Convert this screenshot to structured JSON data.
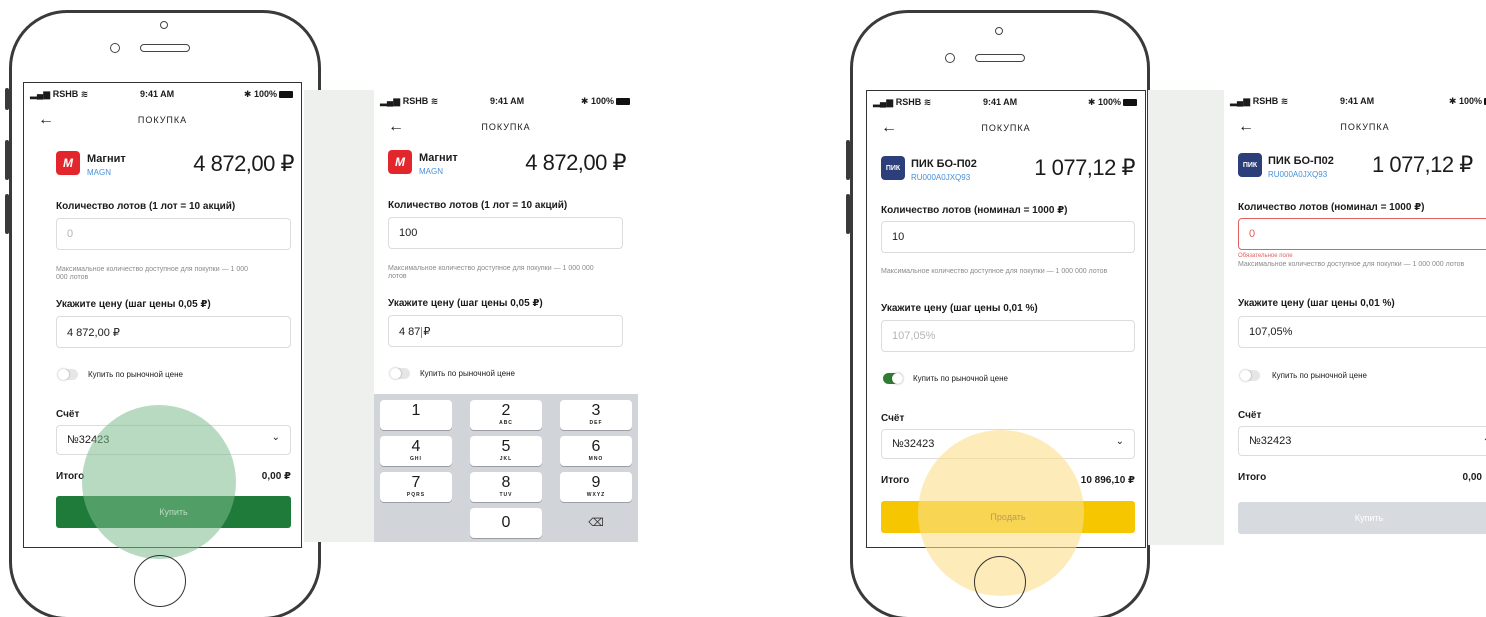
{
  "status_bar": {
    "carrier": "RSHB",
    "wifi": "≋",
    "time": "9:41 AM",
    "battery": "100%"
  },
  "screens": {
    "s1": {
      "nav_title": "ПОКУПКА",
      "back": "←",
      "logo": "M",
      "name": "Магнит",
      "code": "MAGN",
      "price": "4 872,00 ₽",
      "lots_label": "Количество лотов (1 лот = 10 акций)",
      "lots_value": "0",
      "hint": "Максимальное количество доступное для покупки — 1 000 000 лотов",
      "price_label": "Укажите цену (шаг цены 0,05 ₽)",
      "price_value": "4 872,00 ₽",
      "market_label": "Купить по рыночной цене",
      "account_label": "Счёт",
      "account_value": "№32423",
      "total_label": "Итого",
      "total_value": "0,00 ₽",
      "button": "Купить"
    },
    "s2": {
      "nav_title": "ПОКУПКА",
      "back": "←",
      "logo": "M",
      "name": "Магнит",
      "code": "MAGN",
      "price": "4 872,00 ₽",
      "lots_label": "Количество лотов (1 лот = 10 акций)",
      "lots_value": "100",
      "hint": "Максимальное количество доступное для покупки — 1 000 000 лотов",
      "price_label": "Укажите цену (шаг цены 0,05 ₽)",
      "price_value_a": "4 87",
      "price_value_b": "₽",
      "market_label": "Купить по рыночной цене"
    },
    "s3": {
      "nav_title": "ПОКУПКА",
      "back": "←",
      "logo": "ПИК",
      "name": "ПИК БО-П02",
      "code": "RU000A0JXQ93",
      "price": "1 077,12 ₽",
      "lots_label": "Количество лотов (номинал = 1000 ₽)",
      "lots_value": "10",
      "hint": "Максимальное количество доступное для покупки — 1 000 000 лотов",
      "price_label": "Укажите цену (шаг цены 0,01 %)",
      "price_value": "107,05%",
      "market_label": "Купить по рыночной цене",
      "account_label": "Счёт",
      "account_value": "№32423",
      "total_label": "Итого",
      "total_value": "10 896,10 ₽",
      "button": "Продать"
    },
    "s4": {
      "nav_title": "ПОКУПКА",
      "back": "←",
      "logo": "ПИК",
      "name": "ПИК БО-П02",
      "code": "RU000A0JXQ93",
      "price": "1 077,12 ₽",
      "lots_label": "Количество лотов (номинал = 1000 ₽)",
      "lots_value": "0",
      "error": "Обязательное поле",
      "hint": "Максимальное количество доступное для покупки — 1 000 000 лотов",
      "price_label": "Укажите цену (шаг цены 0,01 %)",
      "price_value": "107,05%",
      "market_label": "Купить по рыночной цене",
      "account_label": "Счёт",
      "account_value": "№32423",
      "total_label": "Итого",
      "total_value": "0,00",
      "button": "Купить"
    }
  },
  "keypad": [
    {
      "d": "1",
      "l": ""
    },
    {
      "d": "2",
      "l": "ABC"
    },
    {
      "d": "3",
      "l": "DEF"
    },
    {
      "d": "4",
      "l": "GHI"
    },
    {
      "d": "5",
      "l": "JKL"
    },
    {
      "d": "6",
      "l": "MNO"
    },
    {
      "d": "7",
      "l": "PQRS"
    },
    {
      "d": "8",
      "l": "TUV"
    },
    {
      "d": "9",
      "l": "WXYZ"
    },
    {
      "d": "0",
      "l": ""
    }
  ],
  "keypad_delete_icon": "⌫",
  "colors": {
    "green": "#1f7b3a",
    "yellow": "#f6c700",
    "red": "#e3262c",
    "navy": "#2d3f7a",
    "link": "#4a8fd8"
  }
}
